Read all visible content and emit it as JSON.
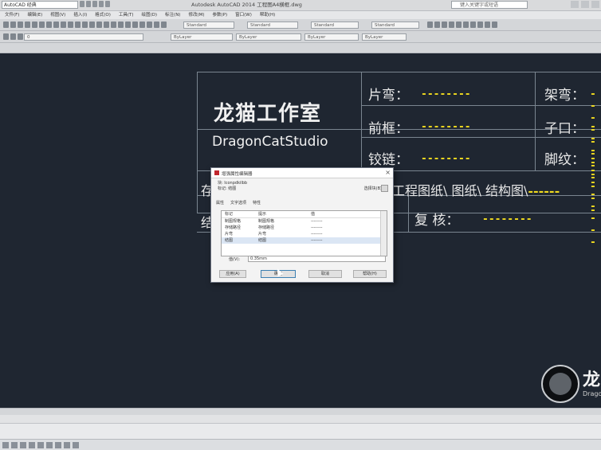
{
  "app": {
    "title": "Autodesk AutoCAD 2014    工程图A4横框.dwg",
    "workspace": "AutoCAD 经典",
    "search_placeholder": "键入关键字或短语"
  },
  "menu": [
    "文件(F)",
    "编辑(E)",
    "视图(V)",
    "插入(I)",
    "格式(O)",
    "工具(T)",
    "绘图(D)",
    "标注(N)",
    "修改(M)",
    "参数(P)",
    "窗口(W)",
    "帮助(H)"
  ],
  "toolbars": {
    "layer": "0",
    "color": "ByLayer",
    "linetype": "ByLayer",
    "lineweight": "ByLayer",
    "style": "Standard"
  },
  "title_block": {
    "studio_cn": "龙猫工作室",
    "studio_en": "DragonCatStudio",
    "fields": [
      {
        "label": "片弯：",
        "value": "--------"
      },
      {
        "label": "架弯：",
        "value": "--------"
      },
      {
        "label": "前框：",
        "value": "--------"
      },
      {
        "label": "子口：",
        "value": "--------"
      },
      {
        "label": "铰链：",
        "value": "--------"
      },
      {
        "label": "脚纹：",
        "value": "--------"
      },
      {
        "label": "复 核：",
        "value": "--------"
      }
    ],
    "path_text": "工程图纸\\ 图纸\\ 结构图\\",
    "path_dash": "------",
    "left_char_1": "存",
    "left_char_2": "结"
  },
  "logo": {
    "cn": "龙",
    "en": "Dragon"
  },
  "dialog": {
    "title": "增强属性编辑器",
    "block_label": "块: Iconpdkilbb",
    "tag_label": "标记: 结图",
    "select_block": "选择块(B)",
    "tabs": [
      "属性",
      "文字选项",
      "特性"
    ],
    "columns": [
      "标记",
      "提示",
      "值"
    ],
    "rows": [
      {
        "tag": "标记",
        "prompt": "提示",
        "value": "值"
      },
      {
        "tag": "制图规格",
        "prompt": "制图规格",
        "value": "--------"
      },
      {
        "tag": "存储路径",
        "prompt": "存储路径",
        "value": "--------"
      },
      {
        "tag": "片弯",
        "prompt": "片弯",
        "value": "--------"
      },
      {
        "tag": "结图",
        "prompt": "结图",
        "value": "--------"
      }
    ],
    "value_label": "值(V):",
    "value": "0.35mm",
    "buttons": [
      "应用(A)",
      "确定",
      "取消",
      "帮助(H)"
    ]
  }
}
